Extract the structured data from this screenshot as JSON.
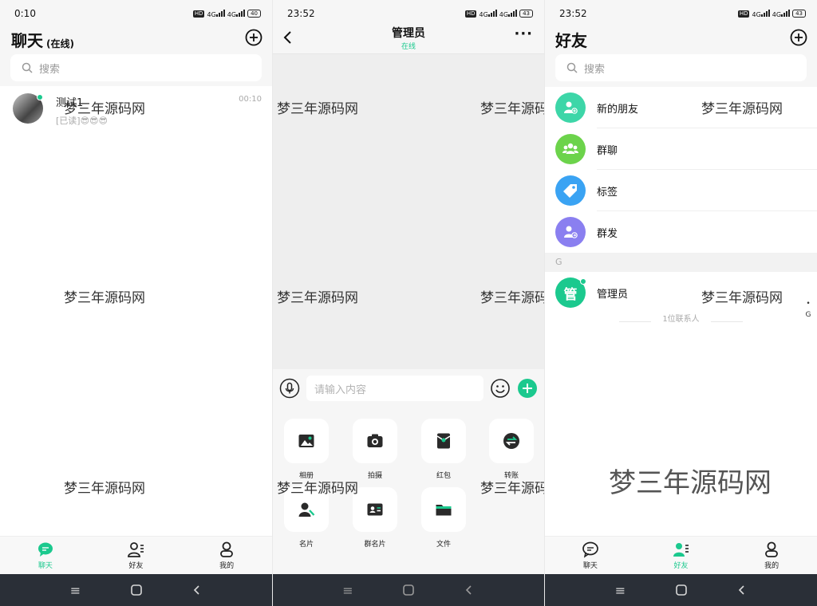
{
  "screens": {
    "chats": {
      "status_time": "0:10",
      "battery": "40",
      "title": "聊天",
      "title_sub": "(在线)",
      "search_placeholder": "搜索",
      "chat_items": [
        {
          "name": "测试1",
          "preview": "[已读]😎😎😎",
          "time": "00:10"
        }
      ]
    },
    "conversation": {
      "status_time": "23:52",
      "battery": "43",
      "title": "管理员",
      "subtitle": "在线",
      "input_placeholder": "请输入内容",
      "tools": [
        {
          "label": "相册",
          "icon": "photo-icon"
        },
        {
          "label": "拍摄",
          "icon": "camera-icon"
        },
        {
          "label": "红包",
          "icon": "red-packet-icon"
        },
        {
          "label": "转账",
          "icon": "transfer-icon"
        },
        {
          "label": "名片",
          "icon": "contact-card-icon"
        },
        {
          "label": "群名片",
          "icon": "group-card-icon"
        },
        {
          "label": "文件",
          "icon": "folder-icon"
        }
      ]
    },
    "friends": {
      "status_time": "23:52",
      "battery": "43",
      "title": "好友",
      "search_placeholder": "搜索",
      "entries": [
        {
          "label": "新的朋友",
          "icon": "new-friend-icon",
          "color": "#3dd6a8"
        },
        {
          "label": "群聊",
          "icon": "group-chat-icon",
          "color": "#6cd34b"
        },
        {
          "label": "标签",
          "icon": "tag-icon",
          "color": "#3aa3f3"
        },
        {
          "label": "群发",
          "icon": "broadcast-icon",
          "color": "#8a7ff0"
        }
      ],
      "section_letter": "G",
      "contacts": [
        {
          "name": "管理员",
          "avatar_text": "管"
        }
      ],
      "contact_count": "1位联系人",
      "index_letter": "G",
      "index_dot": "•"
    }
  },
  "tabbar": {
    "chat": "聊天",
    "friends": "好友",
    "me": "我的"
  },
  "watermark": "梦三年源码网",
  "colors": {
    "accent": "#1bc98e",
    "navbar": "#2a2f37"
  }
}
